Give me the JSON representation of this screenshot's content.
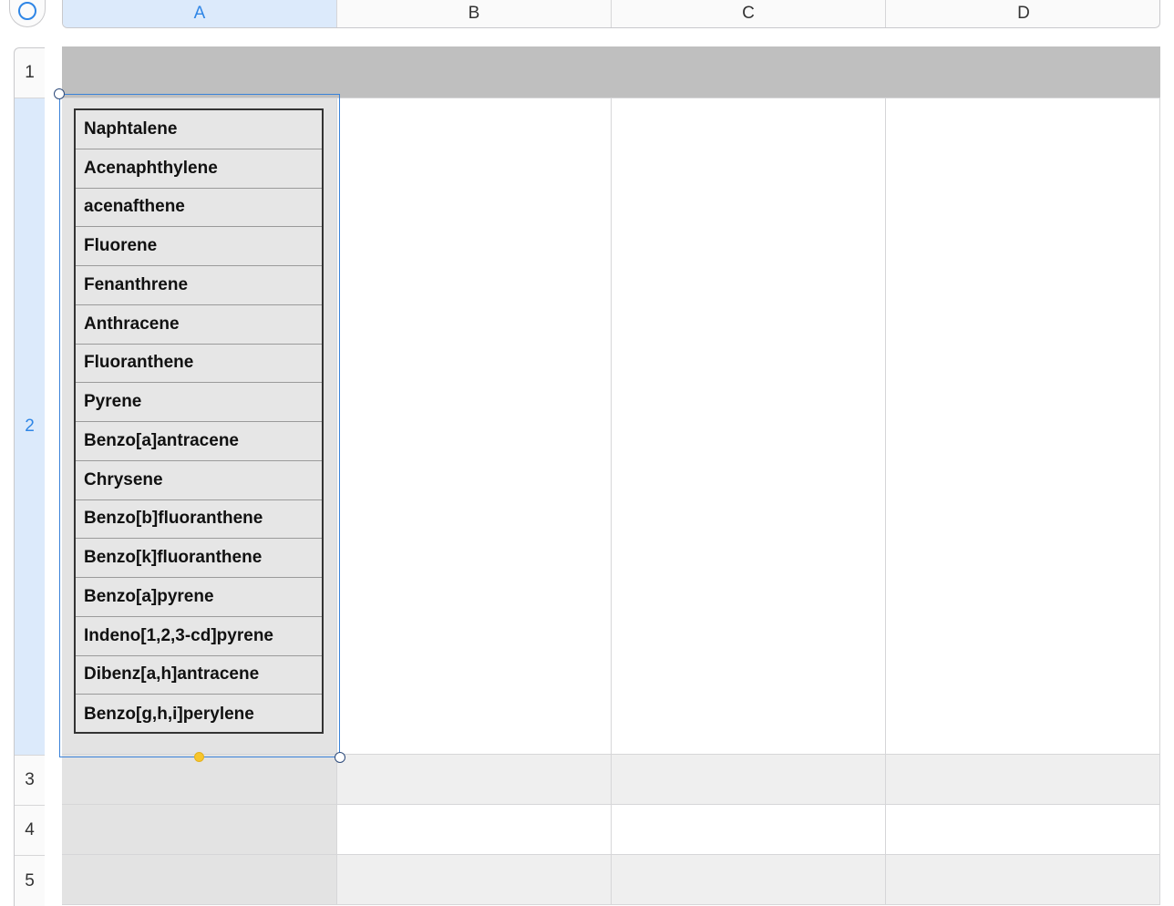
{
  "columns": [
    "A",
    "B",
    "C",
    "D"
  ],
  "rows": [
    "1",
    "2",
    "3",
    "4",
    "5"
  ],
  "selected_column": "A",
  "selected_row": "2",
  "colors": {
    "header_row_fill": "#bfbfbf",
    "selection_accent": "#2f86e6",
    "alt_row_fill": "#efefef",
    "column_a_fill": "#e3e3e3"
  },
  "cell_A2_image": {
    "items": [
      "Naphtalene",
      "Acenaphthylene",
      "acenafthene",
      "Fluorene",
      "Fenanthrene",
      "Anthracene",
      "Fluoranthene",
      "Pyrene",
      "Benzo[a]antracene",
      "Chrysene",
      "Benzo[b]fluoranthene",
      "Benzo[k]fluoranthene",
      "Benzo[a]pyrene",
      "Indeno[1,2,3-cd]pyrene",
      "Dibenz[a,h]antracene",
      "Benzo[g,h,i]perylene"
    ]
  }
}
